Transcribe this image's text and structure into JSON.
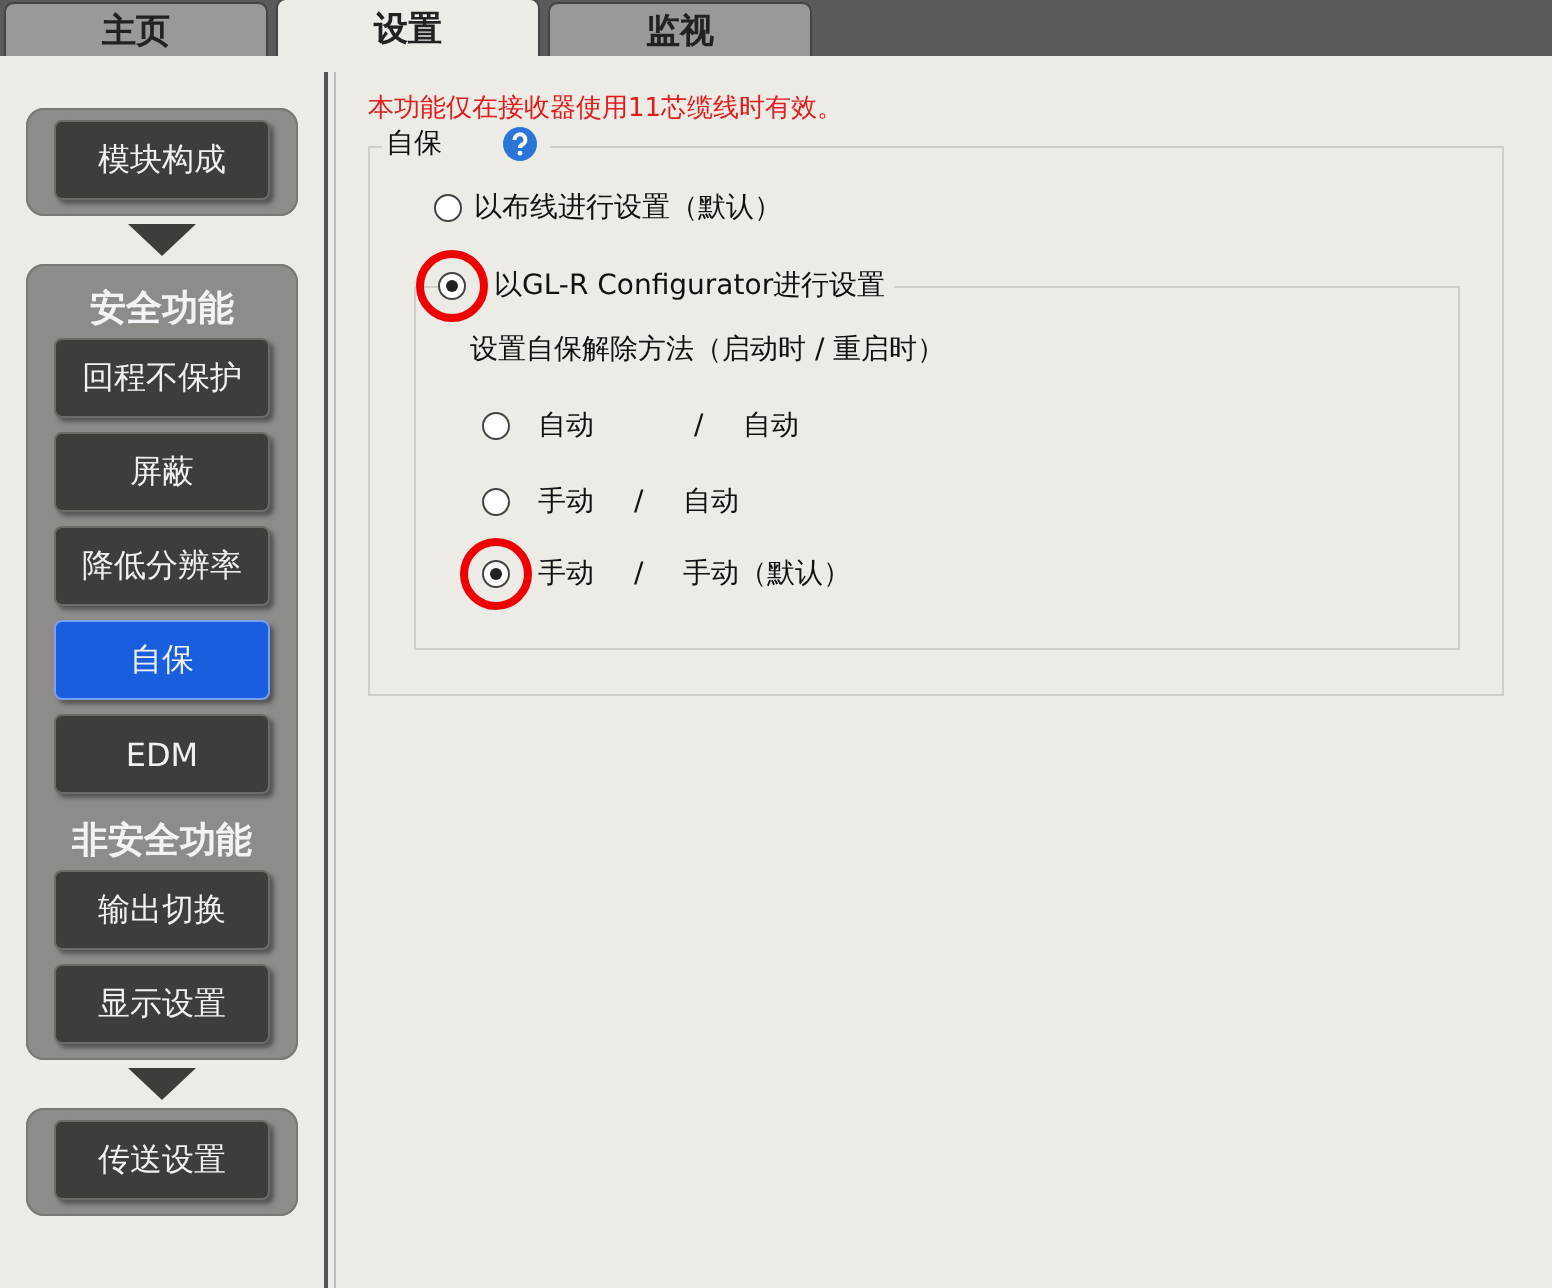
{
  "tabs": [
    {
      "label": "主页",
      "selected": false
    },
    {
      "label": "设置",
      "selected": true
    },
    {
      "label": "监视",
      "selected": false
    }
  ],
  "sidebar": {
    "groups": [
      {
        "sections": [
          {
            "items": [
              {
                "label": "模块构成",
                "selected": false
              }
            ]
          }
        ]
      },
      {
        "sections": [
          {
            "title": "安全功能",
            "items": [
              {
                "label": "回程不保护",
                "selected": false
              },
              {
                "label": "屏蔽",
                "selected": false
              },
              {
                "label": "降低分辨率",
                "selected": false
              },
              {
                "label": "自保",
                "selected": true
              },
              {
                "label": "EDM",
                "selected": false
              }
            ]
          },
          {
            "title": "非安全功能",
            "items": [
              {
                "label": "输出切换",
                "selected": false
              },
              {
                "label": "显示设置",
                "selected": false
              }
            ]
          }
        ]
      },
      {
        "sections": [
          {
            "items": [
              {
                "label": "传送设置",
                "selected": false
              }
            ]
          }
        ]
      }
    ]
  },
  "notice": "本功能仅在接收器使用11芯缆线时有效。",
  "group": {
    "title": "自保",
    "modes": [
      {
        "label": "以布线进行设置（默认）",
        "selected": false,
        "highlighted": false
      },
      {
        "label": "以GL-R Configurator进行设置",
        "selected": true,
        "highlighted": true
      }
    ],
    "sub_title": "设置自保解除方法（启动时 / 重启时）",
    "methods": [
      {
        "start": "自动",
        "separator": "/",
        "restart": "自动",
        "selected": false,
        "highlighted": false
      },
      {
        "start": "手动",
        "separator": "/",
        "restart": "自动",
        "selected": false,
        "highlighted": false
      },
      {
        "start": "手动",
        "separator": "/",
        "restart": "手动（默认）",
        "selected": true,
        "highlighted": true
      }
    ]
  }
}
